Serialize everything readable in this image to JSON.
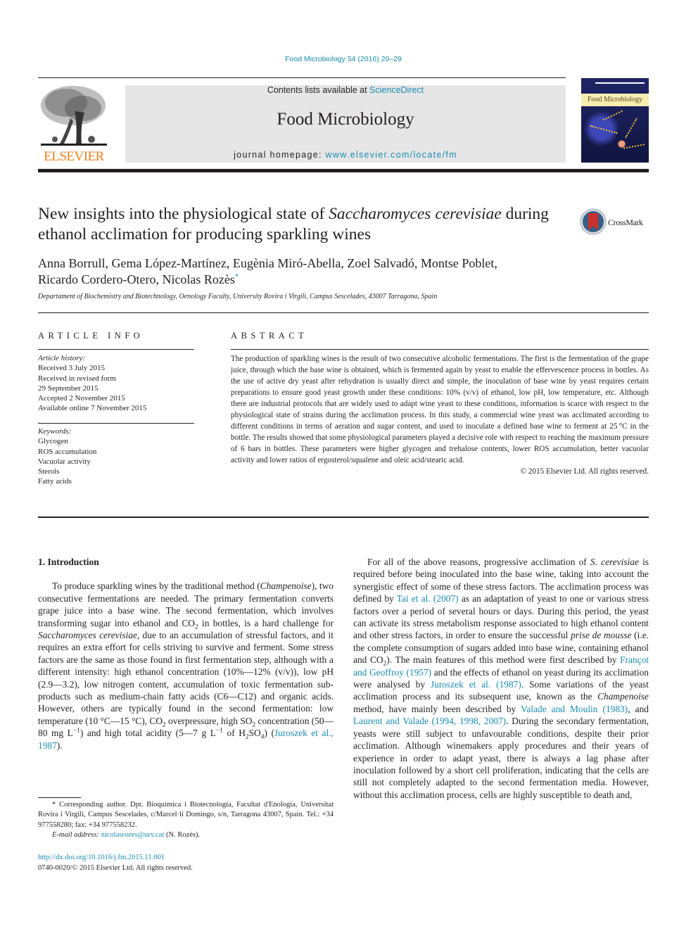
{
  "header": {
    "citation": "Food Microbiology 54 (2016) 20–29",
    "contents_prefix": "Contents lists available at ",
    "contents_link": "ScienceDirect",
    "journal_title": "Food Microbiology",
    "homepage_prefix": "journal homepage: ",
    "homepage_link": "www.elsevier.com/locate/fm",
    "publisher_logo_text": "ELSEVIER",
    "cover_title": "Food Microbiology",
    "crossmark_label": "CrossMark"
  },
  "article": {
    "title_part1": "New insights into the physiological state of ",
    "title_italic": "Saccharomyces cerevisiae",
    "title_part2": " during ethanol acclimation for producing sparkling wines",
    "authors_line1": "Anna Borrull, Gema López-Martínez, Eugènia Miró-Abella, Zoel Salvadó, Montse Poblet,",
    "authors_line2": "Ricardo Cordero-Otero, Nicolas Rozès",
    "corresponding_mark": "*",
    "affiliation": "Departament of Biochemistry and Biotechnology, Oenology Faculty, University Rovira i Virgili, Campus Sescelades, 43007 Tarragona, Spain"
  },
  "article_info": {
    "heading": "ARTICLE INFO",
    "history_label": "Article history:",
    "history": [
      "Received 3 July 2015",
      "Received in revised form",
      "29 September 2015",
      "Accepted 2 November 2015",
      "Available online 7 November 2015"
    ],
    "keywords_label": "Keywords:",
    "keywords": [
      "Glycogen",
      "ROS accumulation",
      "Vacuolar activity",
      "Sterols",
      "Fatty acids"
    ]
  },
  "abstract": {
    "heading": "ABSTRACT",
    "text": "The production of sparkling wines is the result of two consecutive alcoholic fermentations. The first is the fermentation of the grape juice, through which the base wine is obtained, which is fermented again by yeast to enable the effervescence process in bottles. As the use of active dry yeast after rehydration is usually direct and simple, the inoculation of base wine by yeast requires certain preparations to ensure good yeast growth under these conditions: 10% (v/v) of ethanol, low pH, low temperature, etc. Although there are industrial protocols that are widely used to adapt wine yeast to these conditions, information is scarce with respect to the physiological state of strains during the acclimation process. In this study, a commercial wine yeast was acclimated according to different conditions in terms of aeration and sugar content, and used to inoculate a defined base wine to ferment at 25 °C in the bottle. The results showed that some physiological parameters played a decisive role with respect to reaching the maximum pressure of 6 bars in bottles. These parameters were higher glycogen and trehalose contents, lower ROS accumulation, better vacuolar activity and lower ratios of ergosterol/squalene and oleic acid/stearic acid.",
    "copyright": "© 2015 Elsevier Ltd. All rights reserved."
  },
  "introduction": {
    "heading": "1.  Introduction",
    "p1": {
      "a": "To produce sparkling wines by the traditional method (",
      "a_it": "Champenoise",
      "b": "), two consecutive fermentations are needed. The primary fermentation converts grape juice into a base wine. The second fermentation, which involves transforming sugar into ethanol and CO",
      "b_sub": "2",
      "c": " in bottles, is a hard challenge for ",
      "c_it": "Saccharomyces cerevisiae",
      "d": ", due to an accumulation of stressful factors, and it requires an extra effort for cells striving to survive and ferment. Some stress factors are the same as those found in first fermentation step, although with a different intensity: high ethanol concentration (10%—12% (v/v)), low pH (2.9—3.2), low nitrogen content, accumulation of toxic fermentation sub-products such as medium-chain fatty acids (C6—C12) and organic acids. However, others are typically found in the second fermentation: low temperature (10 °C—15 °C), CO",
      "d_sub": "2",
      "e": " overpressure, high SO",
      "e_sub": "2",
      "f": " concentration (50—80 mg L",
      "f_sup": "−1",
      "g": ") and high total acidity (5—7 g L",
      "g_sup": "−1",
      "h": " of H",
      "h_sub": "2",
      "i": "SO",
      "i_sub": "4",
      "j": ") (",
      "ref": "Juroszek et al., 1987",
      "k": ")."
    },
    "p2": {
      "a": "For all of the above reasons, progressive acclimation of ",
      "a_it": "S. cerevisiae",
      "b": " is required before being inoculated into the base wine, taking into account the synergistic effect of some of these stress factors. The acclimation process was defined by ",
      "ref1": "Tai et al. (2007)",
      "c": " as an adaptation of yeast to one or various stress factors over a period of several hours or days. During this period, the yeast can activate its stress metabolism response associated to high ethanol content and other stress factors, in order to ensure the successful ",
      "c_it": "prise de mousse",
      "d": " (i.e. the complete consumption of sugars added into base wine, containing ethanol and CO",
      "d_sub": "2",
      "e": "). The main features of this method were first described by ",
      "ref2": "Françot and Geoffroy (1957)",
      "f": " and the effects of ethanol on yeast during its acclimation were analysed by ",
      "ref3": "Juroszek et al. (1987)",
      "g": ". Some variations of the yeast acclimation process and its subsequent use, known as the ",
      "g_it": "Champenoise",
      "h": " method, have mainly been described by ",
      "ref4": "Valade and Moulin (1983)",
      "i": ", and ",
      "ref5": "Laurent and Valade (1994, 1998, 2007)",
      "j": ". During the secondary fermentation, yeasts were still subject to unfavourable conditions, despite their prior acclimation. Although winemakers apply procedures and their years of experience in order to adapt yeast, there is always a lag phase after inoculation followed by a short cell proliferation, indicating that the cells are still not completely adapted to the second fermentation media. However, without this acclimation process, cells are highly susceptible to death and,"
    }
  },
  "footnote": {
    "corresponding": "* Corresponding author. Dpt. Bioquímica i Biotecnología, Facultat d'Enologia, Universitat Rovira i Virgili, Campus Sescelades, c/Marcel·lí Domingo, s/n, Tarragona 43007, Spain. Tel.: +34 977558280; fax: +34 977558232.",
    "email_label": "E-mail address: ",
    "email": "nicolasrozes@urv.cat",
    "email_suffix": " (N. Rozès).",
    "doi": "http://dx.doi.org/10.1016/j.fm.2015.11.001",
    "issn_copyright": "0740-0020/© 2015 Elsevier Ltd. All rights reserved."
  },
  "colors": {
    "link": "#1a8bb3",
    "elsevier_orange": "#f07f1a",
    "masthead_gray": "#e6e6e6",
    "text": "#231f20"
  }
}
